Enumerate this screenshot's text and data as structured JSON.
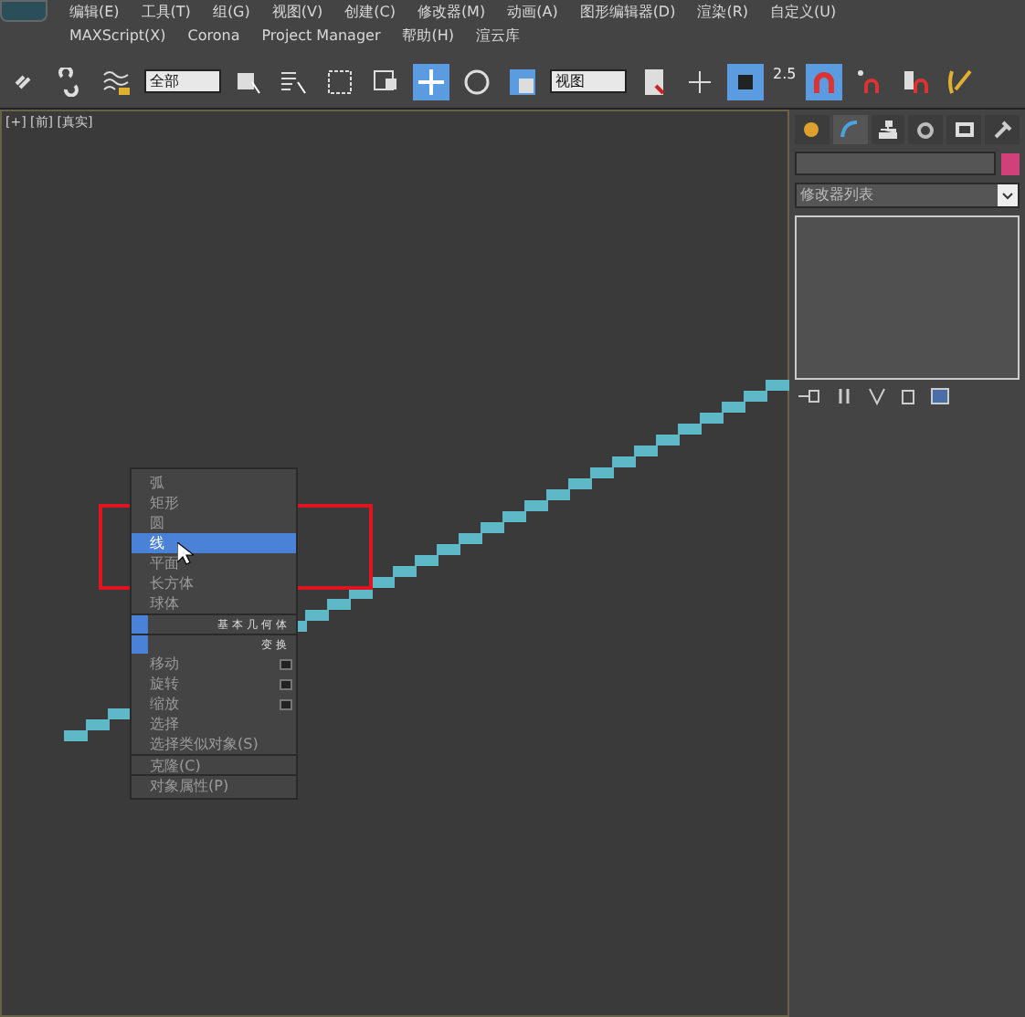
{
  "menu_bar": {
    "main_menus": [
      "编辑(E)",
      "工具(T)",
      "组(G)",
      "视图(V)",
      "创建(C)",
      "修改器(M)",
      "动画(A)",
      "图形编辑器(D)",
      "渲染(R)",
      "自定义(U)"
    ],
    "wrapped_menus": [
      "MAXScript(X)",
      "Corona",
      "Project Manager",
      "帮助(H)",
      "渲云库"
    ]
  },
  "toolbar": {
    "selection_filter": "全部",
    "reference_coord": "视图",
    "snap_angle": "2.5"
  },
  "viewport": {
    "label": "[+] [前] [真实]"
  },
  "context_menu": {
    "items": [
      {
        "kind": "item",
        "label": "弧",
        "selected": false
      },
      {
        "kind": "item",
        "label": "矩形",
        "selected": false
      },
      {
        "kind": "item",
        "label": "圆",
        "selected": false
      },
      {
        "kind": "item",
        "label": "线",
        "selected": true
      },
      {
        "kind": "item",
        "label": "平面",
        "selected": false
      },
      {
        "kind": "item",
        "label": "长方体",
        "selected": false
      },
      {
        "kind": "item",
        "label": "球体",
        "selected": false
      },
      {
        "kind": "header",
        "label": "基本几何体"
      },
      {
        "kind": "header",
        "label": "变换"
      },
      {
        "kind": "item",
        "label": "移动",
        "selected": false,
        "has_settings": true
      },
      {
        "kind": "item",
        "label": "旋转",
        "selected": false,
        "has_settings": true
      },
      {
        "kind": "item",
        "label": "缩放",
        "selected": false,
        "has_settings": true
      },
      {
        "kind": "item",
        "label": "选择",
        "selected": false
      },
      {
        "kind": "item",
        "label": "选择类似对象(S)",
        "selected": false
      },
      {
        "kind": "separator_item",
        "label": "克隆(C)",
        "selected": false
      },
      {
        "kind": "separator_item",
        "label": "对象属性(P)",
        "selected": false
      }
    ]
  },
  "command_panel": {
    "modifier_list": "修改器列表"
  }
}
